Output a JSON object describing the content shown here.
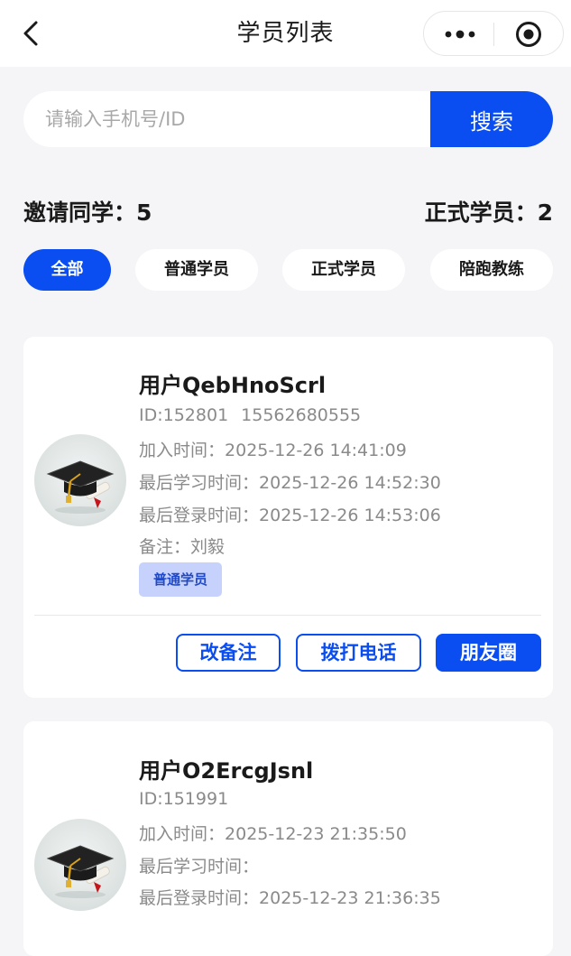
{
  "navbar": {
    "title": "学员列表",
    "back_icon": "chevron-left-icon",
    "more_icon": "more-dots-icon",
    "target_icon": "target-circle-icon"
  },
  "search": {
    "placeholder": "请输入手机号/ID",
    "value": "",
    "button_label": "搜索"
  },
  "stats": {
    "invited_label": "邀请同学：",
    "invited_count": "5",
    "formal_label": "正式学员：",
    "formal_count": "2"
  },
  "filters": [
    {
      "label": "全部",
      "active": true
    },
    {
      "label": "普通学员",
      "active": false
    },
    {
      "label": "正式学员",
      "active": false
    },
    {
      "label": "陪跑教练",
      "active": false
    }
  ],
  "students": [
    {
      "name": "用户QebHnoScrl",
      "id_text": "ID:152801",
      "phone": "15562680555",
      "join_label": "加入时间：",
      "join_time": "2025-12-26 14:41:09",
      "last_study_label": "最后学习时间：",
      "last_study_time": "2025-12-26 14:52:30",
      "last_login_label": "最后登录时间：",
      "last_login_time": "2025-12-26 14:53:06",
      "note_label": "备注：",
      "note": "刘毅",
      "tag": "普通学员",
      "actions": {
        "edit_note": "改备注",
        "call": "拨打电话",
        "moments": "朋友圈"
      }
    },
    {
      "name": "用户O2ErcgJsnl",
      "id_text": "ID:151991",
      "phone": "",
      "join_label": "加入时间：",
      "join_time": "2025-12-23 21:35:50",
      "last_study_label": "最后学习时间：",
      "last_study_time": "",
      "last_login_label": "最后登录时间：",
      "last_login_time": "2025-12-23 21:36:35"
    }
  ],
  "colors": {
    "accent": "#0a4df0",
    "tag_bg": "#c6d2fb",
    "page_bg": "#f5f5f7"
  }
}
